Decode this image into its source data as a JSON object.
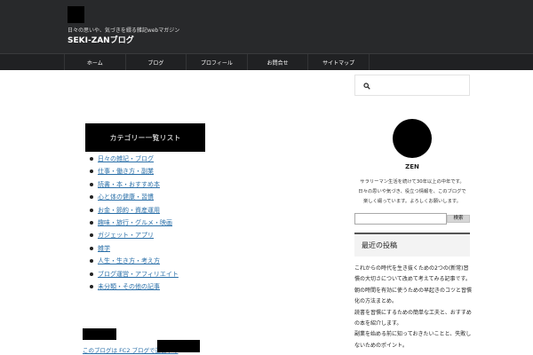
{
  "header": {
    "tagline": "日々の思いや、気づきを綴る雑記webマガジン",
    "site_title": "SEKI-ZANブログ"
  },
  "nav": {
    "items": [
      "ホーム",
      "ブログ",
      "プロフィール",
      "お問合せ",
      "サイトマップ"
    ]
  },
  "main": {
    "category_heading": "カテゴリー一覧リスト",
    "categories": [
      "日々の雑記・ブログ",
      "仕事・働き方・副業",
      "読書・本・おすすめ本",
      "心と体の健康・習慣",
      "お金・節約・資産運用",
      "趣味・旅行・グルメ・映画",
      "ガジェット・アプリ",
      "雑学",
      "人生・生き方・考え方",
      "ブログ運営・アフィリエイト",
      "未分類・その他の記事"
    ],
    "bottom_link": "このブログは FC2 ブログで運営中の"
  },
  "sidebar": {
    "profile_name": "ZEN",
    "profile_desc": "サラリーマン生活を続けて30年以上の中年です。日々の思いや気づき、役立つ情報を、このブログで楽しく綴っています。よろしくお願いします。",
    "search_button": "検索",
    "recent_heading": "最近の投稿",
    "recent_posts": [
      "これからの時代を生き抜くための2つの(新常)習慣の大切さについて改めて考えてみる記事です。",
      "朝の時間を有効に使うための早起きのコツと習慣化の方法まとめ。",
      "読書を習慣にするための簡単な工夫と、おすすめの本を紹介します。",
      "副業を始める前に知っておきたいことと、失敗しないためのポイント。"
    ]
  }
}
